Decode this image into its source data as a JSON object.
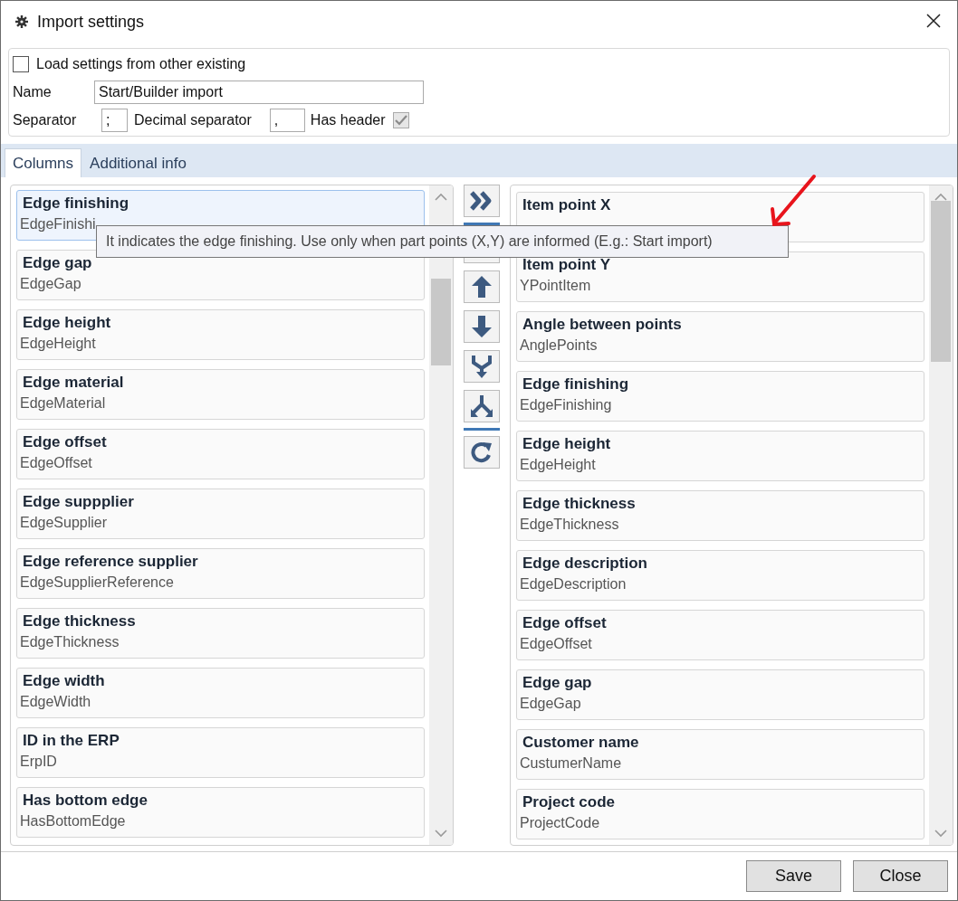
{
  "window": {
    "title": "Import settings"
  },
  "settings": {
    "load_from_existing": {
      "label": "Load settings from other existing",
      "checked": false
    },
    "name": {
      "label": "Name",
      "value": "Start/Builder import"
    },
    "separator": {
      "label": "Separator",
      "value": ";"
    },
    "decimal_separator": {
      "label": "Decimal separator",
      "value": ","
    },
    "has_header": {
      "label": "Has header",
      "checked": true,
      "disabled": true
    }
  },
  "tabs": [
    {
      "label": "Columns",
      "selected": true
    },
    {
      "label": "Additional info",
      "selected": false
    }
  ],
  "available_columns": [
    {
      "title": "Edge finishing",
      "field": "EdgeFinishi",
      "selected": true
    },
    {
      "title": "Edge gap",
      "field": "EdgeGap",
      "selected": false
    },
    {
      "title": "Edge height",
      "field": "EdgeHeight",
      "selected": false
    },
    {
      "title": "Edge material",
      "field": "EdgeMaterial",
      "selected": false
    },
    {
      "title": "Edge offset",
      "field": "EdgeOffset",
      "selected": false
    },
    {
      "title": "Edge suppplier",
      "field": "EdgeSupplier",
      "selected": false
    },
    {
      "title": "Edge reference supplier",
      "field": "EdgeSupplierReference",
      "selected": false
    },
    {
      "title": "Edge thickness",
      "field": "EdgeThickness",
      "selected": false
    },
    {
      "title": "Edge width",
      "field": "EdgeWidth",
      "selected": false
    },
    {
      "title": "ID in the ERP",
      "field": "ErpID",
      "selected": false
    },
    {
      "title": "Has bottom edge",
      "field": "HasBottomEdge",
      "selected": false
    }
  ],
  "toolbar": [
    {
      "kind": "add-all"
    },
    {
      "kind": "separator"
    },
    {
      "kind": "covered"
    },
    {
      "kind": "up"
    },
    {
      "kind": "down"
    },
    {
      "kind": "merge"
    },
    {
      "kind": "split"
    },
    {
      "kind": "separator"
    },
    {
      "kind": "refresh"
    }
  ],
  "selected_columns": [
    {
      "title": "Item point X",
      "selected": false
    },
    {
      "title": "Item point Y",
      "field": "YPointItem",
      "selected": false
    },
    {
      "title": "Angle between points",
      "field": "AnglePoints",
      "selected": false
    },
    {
      "title": "Edge finishing",
      "field": "EdgeFinishing",
      "selected": false
    },
    {
      "title": "Edge height",
      "field": "EdgeHeight",
      "selected": false
    },
    {
      "title": "Edge thickness",
      "field": "EdgeThickness",
      "selected": false
    },
    {
      "title": "Edge description",
      "field": "EdgeDescription",
      "selected": false
    },
    {
      "title": "Edge offset",
      "field": "EdgeOffset",
      "selected": false
    },
    {
      "title": "Edge gap",
      "field": "EdgeGap",
      "selected": false
    },
    {
      "title": "Customer name",
      "field": "CustumerName",
      "selected": false
    },
    {
      "title": "Project code",
      "field": "ProjectCode",
      "selected": false
    }
  ],
  "tooltip": {
    "text": "It indicates the edge finishing. Use only when part points (X,Y) are informed (E.g.: Start import)"
  },
  "buttons": [
    "Save",
    "Close"
  ]
}
